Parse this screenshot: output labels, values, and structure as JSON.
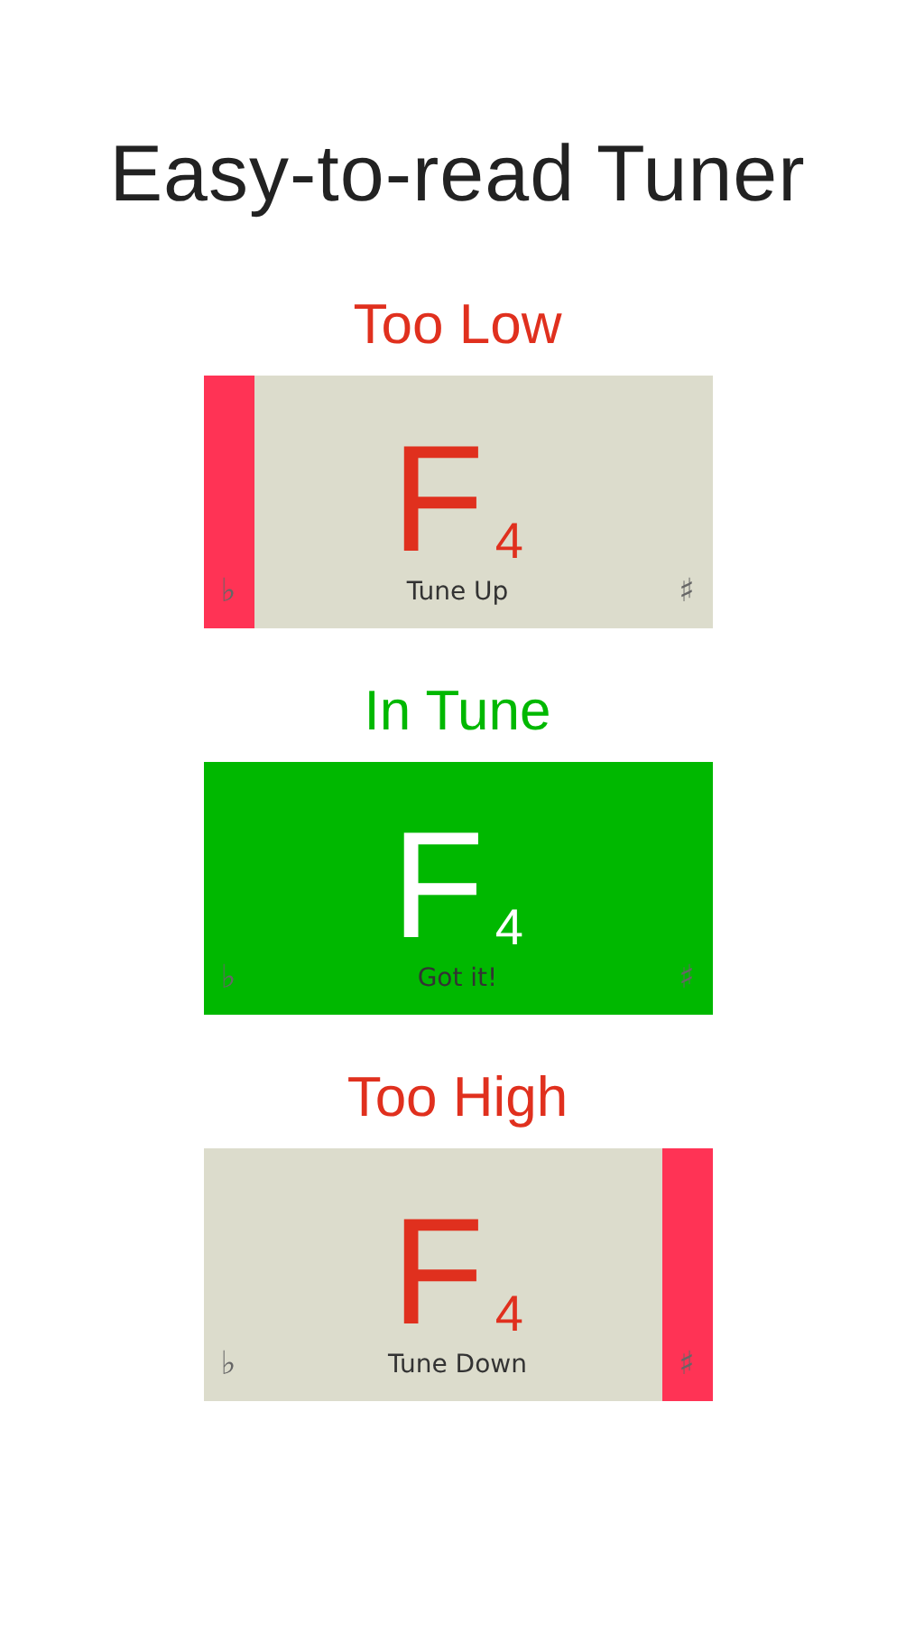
{
  "title": "Easy-to-read Tuner",
  "panels": [
    {
      "status": "Too Low",
      "kind": "low",
      "note": "F",
      "octave": "4",
      "caption": "Tune Up",
      "flat": "♭",
      "sharp": "♯"
    },
    {
      "status": "In Tune",
      "kind": "tune",
      "note": "F",
      "octave": "4",
      "caption": "Got it!",
      "flat": "♭",
      "sharp": "♯"
    },
    {
      "status": "Too High",
      "kind": "high",
      "note": "F",
      "octave": "4",
      "caption": "Tune Down",
      "flat": "♭",
      "sharp": "♯"
    }
  ]
}
